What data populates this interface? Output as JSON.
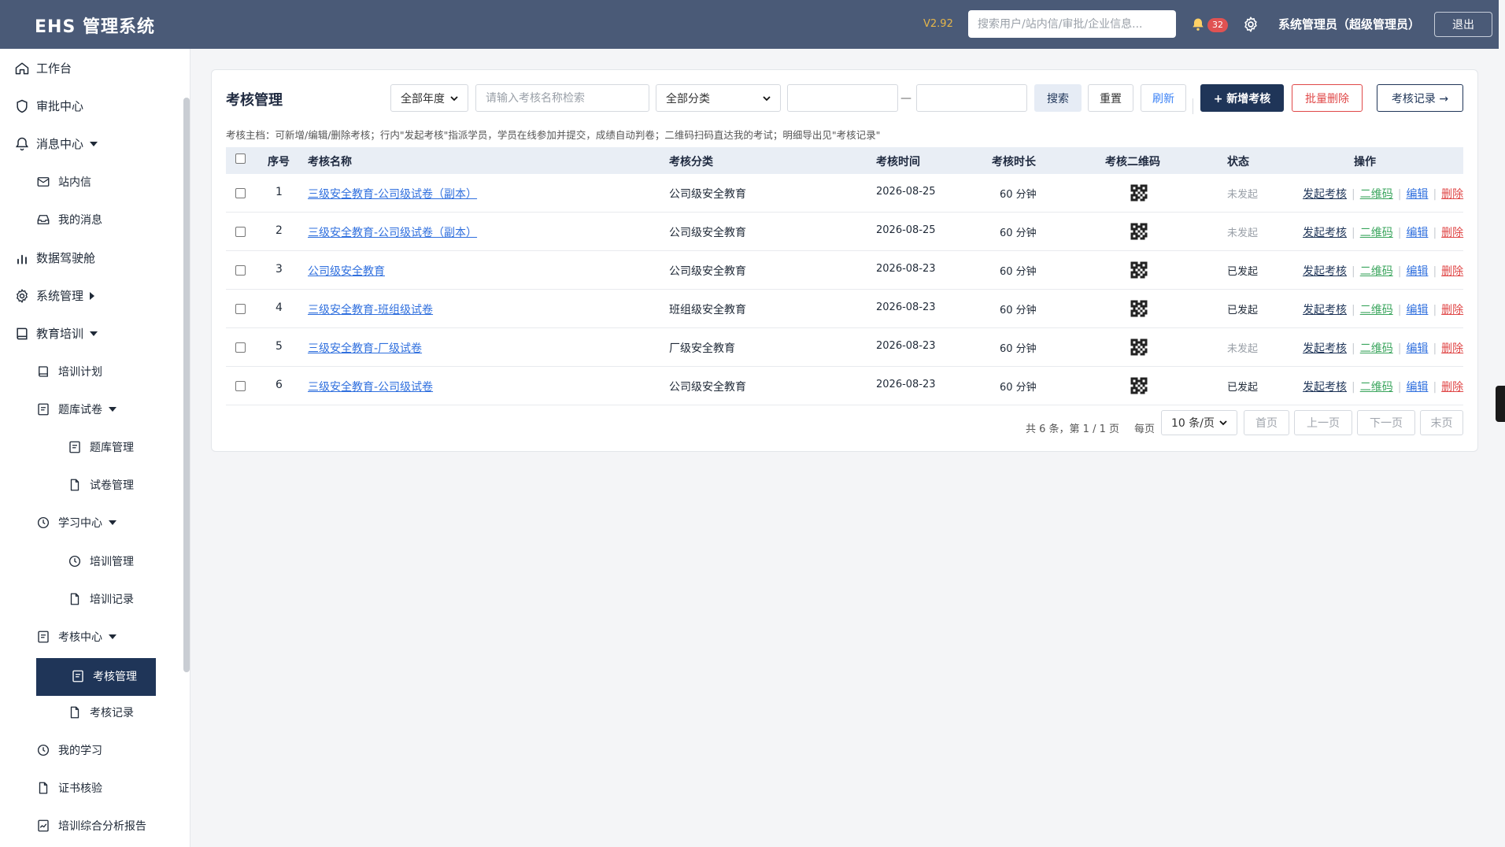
{
  "app": {
    "brand": "EHS 管理系统",
    "version": "V2.92",
    "search_placeholder": "搜索用户/站内信/审批/企业信息...",
    "notification_count": "32",
    "user": "系统管理员（超级管理员）",
    "logout": "退出"
  },
  "sidebar": {
    "workbench": "工作台",
    "approval": "审批中心",
    "messages": "消息中心",
    "inbox": "站内信",
    "my_messages": "我的消息",
    "cockpit": "数据驾驶舱",
    "system": "系统管理",
    "education": "教育培训",
    "training_plan": "培训计划",
    "question_bank": "题库试卷",
    "bank_manage": "题库管理",
    "paper_manage": "试卷管理",
    "study_center": "学习中心",
    "training_manage": "培训管理",
    "training_records": "培训记录",
    "exam_center": "考核中心",
    "exam_manage": "考核管理",
    "exam_records": "考核记录",
    "my_study": "我的学习",
    "cert_check": "证书核验",
    "report": "培训综合分析报告"
  },
  "filters": {
    "title": "考核管理",
    "year": "全部年度",
    "name_placeholder": "请输入考核名称检索",
    "category": "全部分类",
    "date_from": "",
    "date_to": "",
    "dash": "—",
    "search": "搜索",
    "reset": "重置",
    "refresh": "刷新",
    "add": "+ 新增考核",
    "bulk_delete": "批量删除",
    "records": "考核记录 →"
  },
  "hint": "考核主档：可新增/编辑/删除考核；行内\"发起考核\"指派学员，学员在线参加并提交，成绩自动判卷；二维码扫码直达我的考试；明细导出见\"考核记录\"",
  "table": {
    "headers": {
      "index": "序号",
      "name": "考核名称",
      "category": "考核分类",
      "time": "考核时间",
      "duration": "考核时长",
      "qrcode": "考核二维码",
      "status": "状态",
      "ops": "操作"
    },
    "ops": {
      "launch": "发起考核",
      "qr": "二维码",
      "edit": "编辑",
      "delete": "删除",
      "sep": "|"
    },
    "rows": [
      {
        "index": "1",
        "name": "三级安全教育-公司级试卷（副本）",
        "category": "公司级安全教育",
        "time": "2026-08-25",
        "duration": "60 分钟",
        "status": "未发起"
      },
      {
        "index": "2",
        "name": "三级安全教育-公司级试卷（副本）",
        "category": "公司级安全教育",
        "time": "2026-08-25",
        "duration": "60 分钟",
        "status": "未发起"
      },
      {
        "index": "3",
        "name": "公司级安全教育",
        "category": "公司级安全教育",
        "time": "2026-08-23",
        "duration": "60 分钟",
        "status": "已发起"
      },
      {
        "index": "4",
        "name": "三级安全教育-班组级试卷",
        "category": "班组级安全教育",
        "time": "2026-08-23",
        "duration": "60 分钟",
        "status": "已发起"
      },
      {
        "index": "5",
        "name": "三级安全教育-厂级试卷",
        "category": "厂级安全教育",
        "time": "2026-08-23",
        "duration": "60 分钟",
        "status": "未发起"
      },
      {
        "index": "6",
        "name": "三级安全教育-公司级试卷",
        "category": "公司级安全教育",
        "time": "2026-08-23",
        "duration": "60 分钟",
        "status": "已发起"
      }
    ]
  },
  "pager": {
    "info": "共 6 条，第 1 / 1 页",
    "per_label": "每页",
    "per_value": "10 条/页",
    "first": "首页",
    "prev": "上一页",
    "next": "下一页",
    "last": "末页"
  },
  "colors": {
    "topbar": "#4a5a77",
    "primary": "#1f3558",
    "link": "#2f6fde",
    "danger": "#e04848",
    "success": "#3aa55d",
    "version": "#e6b64a"
  }
}
